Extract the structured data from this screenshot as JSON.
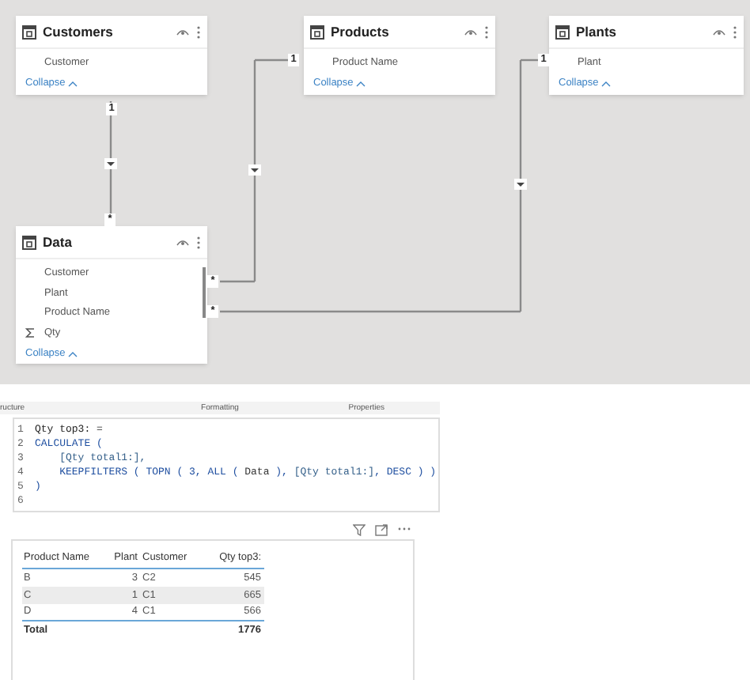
{
  "model_tables": [
    {
      "name": "Customers",
      "fields": [
        {
          "name": "Customer",
          "kind": "column"
        }
      ],
      "collapse": "Collapse",
      "scrollbar": false
    },
    {
      "name": "Products",
      "fields": [
        {
          "name": "Product Name",
          "kind": "column"
        }
      ],
      "collapse": "Collapse",
      "scrollbar": false
    },
    {
      "name": "Plants",
      "fields": [
        {
          "name": "Plant",
          "kind": "column"
        }
      ],
      "collapse": "Collapse",
      "scrollbar": false
    },
    {
      "name": "Data",
      "fields": [
        {
          "name": "Customer",
          "kind": "column"
        },
        {
          "name": "Plant",
          "kind": "column"
        },
        {
          "name": "Product Name",
          "kind": "column"
        },
        {
          "name": "Qty",
          "kind": "measure"
        }
      ],
      "collapse": "Collapse",
      "scrollbar": true
    }
  ],
  "relationships": [
    {
      "one_label": "1",
      "many_label": "*"
    },
    {
      "one_label": "1",
      "many_label": "*"
    },
    {
      "one_label": "1",
      "many_label": "*"
    }
  ],
  "pane_tabs": [
    "ructure",
    "Formatting",
    "Properties"
  ],
  "formula_lines": [
    {
      "number": "1",
      "tokens": [
        {
          "text": "Qty top3: =",
          "kind": "name"
        }
      ]
    },
    {
      "number": "2",
      "tokens": [
        {
          "text": "CALCULATE (",
          "kind": "function"
        }
      ]
    },
    {
      "number": "3",
      "tokens": [
        {
          "text": "    [Qty total1:],",
          "kind": "measure"
        }
      ]
    },
    {
      "number": "4",
      "tokens": [
        {
          "text": "    KEEPFILTERS ( TOPN ( 3, ALL ( ",
          "kind": "function"
        },
        {
          "text": "Data",
          "kind": "table"
        },
        {
          "text": " ), ",
          "kind": "function"
        },
        {
          "text": "[Qty total1:]",
          "kind": "measure"
        },
        {
          "text": ", DESC ) )",
          "kind": "function"
        }
      ]
    },
    {
      "number": "5",
      "tokens": [
        {
          "text": ")",
          "kind": "function"
        }
      ]
    },
    {
      "number": "6"
    }
  ],
  "visual_table": {
    "columns": [
      {
        "label": "Product Name",
        "kind": "text"
      },
      {
        "label": "Plant",
        "kind": "number"
      },
      {
        "label": "Customer",
        "kind": "text"
      },
      {
        "label": "Qty top3:",
        "kind": "number"
      }
    ],
    "rows": [
      {
        "cells": [
          "B",
          "3",
          "C2",
          "545"
        ],
        "selected": false
      },
      {
        "cells": [
          "C",
          "1",
          "C1",
          "665"
        ],
        "selected": true
      },
      {
        "cells": [
          "D",
          "4",
          "C1",
          "566"
        ],
        "selected": false
      }
    ],
    "total": {
      "label": "Total",
      "value": "1776"
    }
  }
}
